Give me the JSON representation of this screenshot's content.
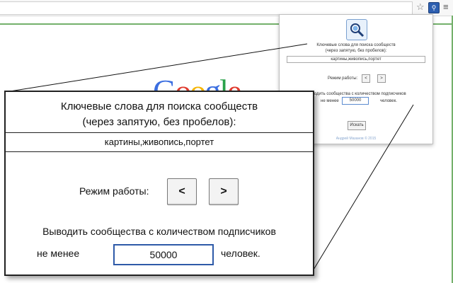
{
  "browser": {
    "star_icon": "star-icon",
    "extension_icon": "magnifier-extension-icon",
    "menu_icon": "hamburger-menu-icon"
  },
  "background": {
    "google_letters": [
      "G",
      "o",
      "o",
      "g",
      "l",
      "e"
    ]
  },
  "popup": {
    "title_line1": "Ключевые слова для поиска сообществ",
    "title_line2": "(через запятую, без пробелов):",
    "keywords_value": "картины,живопись,портет",
    "mode_label": "Режим работы:",
    "prev_label": "<",
    "next_label": ">",
    "subscribers_label": "Выводить сообщества с количеством подписчиков",
    "min_label": "не менее",
    "min_value": "50000",
    "unit_label": "человек.",
    "search_label": "Искать",
    "footer": "Андрей Мазанов © 2015"
  },
  "zoom": {
    "title_line1": "Ключевые слова для поиска сообществ",
    "title_line2": "(через запятую, без пробелов):",
    "keywords_value": "картины,живопись,портет",
    "mode_label": "Режим работы:",
    "prev_label": "<",
    "next_label": ">",
    "subscribers_label": "Выводить сообщества с количеством подписчиков",
    "min_label": "не менее",
    "min_value": "50000",
    "unit_label": "человек."
  },
  "colors": {
    "accent_green": "#74b06b",
    "input_border_blue": "#2e5aa8"
  }
}
